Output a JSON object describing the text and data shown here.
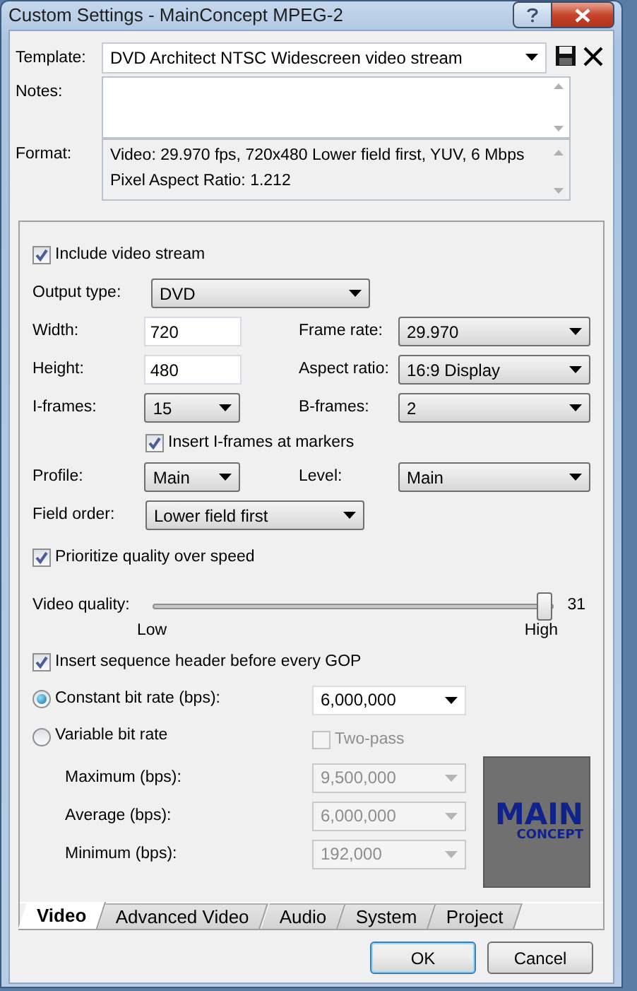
{
  "window": {
    "title": "Custom Settings - MainConcept MPEG-2"
  },
  "template": {
    "label": "Template:",
    "value": "DVD Architect NTSC Widescreen video stream"
  },
  "notes": {
    "label": "Notes:"
  },
  "format": {
    "label": "Format:",
    "lines": [
      "Video: 29.970 fps, 720x480 Lower field first, YUV, 6 Mbps",
      "Pixel Aspect Ratio: 1.212"
    ]
  },
  "video": {
    "include_video": {
      "label": "Include video stream",
      "checked": true
    },
    "output_type": {
      "label": "Output type:",
      "value": "DVD"
    },
    "width": {
      "label": "Width:",
      "value": "720"
    },
    "frame_rate": {
      "label": "Frame rate:",
      "value": "29.970"
    },
    "height": {
      "label": "Height:",
      "value": "480"
    },
    "aspect_ratio": {
      "label": "Aspect ratio:",
      "value": "16:9 Display"
    },
    "i_frames": {
      "label": "I-frames:",
      "value": "15"
    },
    "b_frames": {
      "label": "B-frames:",
      "value": "2"
    },
    "insert_iframes": {
      "label": "Insert I-frames at markers",
      "checked": true
    },
    "profile": {
      "label": "Profile:",
      "value": "Main"
    },
    "level": {
      "label": "Level:",
      "value": "Main"
    },
    "field_order": {
      "label": "Field order:",
      "value": "Lower field first"
    },
    "prioritize": {
      "label": "Prioritize quality over speed",
      "checked": true
    },
    "video_quality": {
      "label": "Video quality:",
      "level": 1.0,
      "reading": "31",
      "min_label": "Low",
      "max_label": "High"
    },
    "insert_seq_header": {
      "label": "Insert sequence header before every GOP",
      "checked": true
    },
    "constant_bit_rate": {
      "label": "Constant bit rate (bps):",
      "selected": true,
      "value": "6,000,000"
    },
    "variable_bit_rate": {
      "label": "Variable bit rate",
      "selected": false
    },
    "two_pass": {
      "label": "Two-pass",
      "checked": false,
      "disabled": true
    },
    "vbr_fields": [
      {
        "label": "Maximum (bps):",
        "value": "9,500,000",
        "disabled": true
      },
      {
        "label": "Average (bps):",
        "value": "6,000,000",
        "disabled": true
      },
      {
        "label": "Minimum (bps):",
        "value": "192,000",
        "disabled": true
      }
    ],
    "logo": {
      "line_1": "MAIN",
      "line_2": "CONCEPT"
    }
  },
  "tabs": [
    {
      "label": "Video",
      "selected": true
    },
    {
      "label": "Advanced Video",
      "selected": false
    },
    {
      "label": "Audio",
      "selected": false
    },
    {
      "label": "System",
      "selected": false
    },
    {
      "label": "Project",
      "selected": false
    }
  ],
  "buttons": [
    {
      "label": "OK",
      "default": true
    },
    {
      "label": "Cancel",
      "default": false
    }
  ]
}
